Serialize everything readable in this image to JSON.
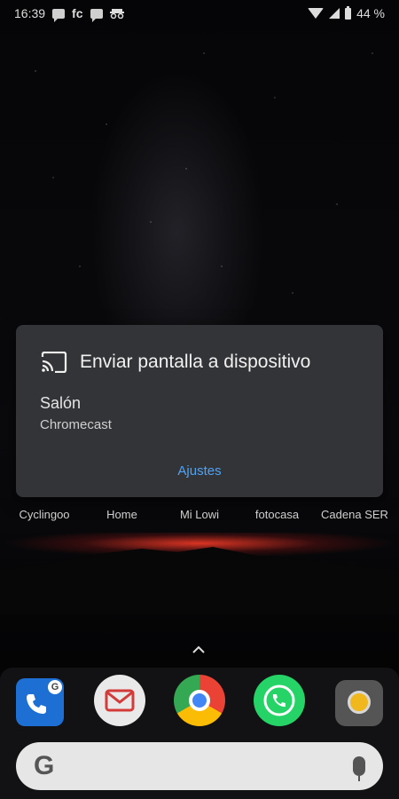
{
  "status_bar": {
    "time": "16:39",
    "notifications": [
      "message-icon",
      "fc",
      "message-icon",
      "incognito-icon"
    ],
    "fc_label": "fc",
    "battery": "44 %"
  },
  "dialog": {
    "icon": "cast-icon",
    "title": "Enviar pantalla a dispositivo",
    "device_name": "Salón",
    "device_type": "Chromecast",
    "settings_label": "Ajustes",
    "accent_color": "#4fa3f7",
    "background_color": "#333437"
  },
  "shortcuts": [
    {
      "label": "Cyclingoo"
    },
    {
      "label": "Home"
    },
    {
      "label": "Mi Lowi"
    },
    {
      "label": "fotocasa"
    },
    {
      "label": "Cadena SER"
    }
  ],
  "dock": {
    "apps": [
      {
        "name": "phone-icon"
      },
      {
        "name": "mail-icon"
      },
      {
        "name": "chrome-icon"
      },
      {
        "name": "whatsapp-icon"
      },
      {
        "name": "camera-icon"
      }
    ],
    "search": {
      "logo": "G",
      "icon": "mic-icon"
    }
  }
}
